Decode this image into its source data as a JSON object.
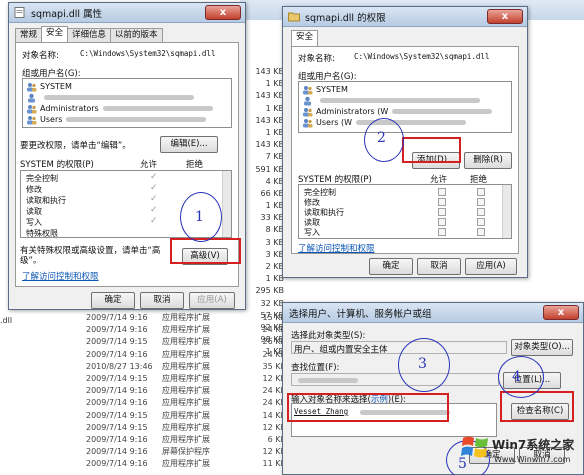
{
  "explorer": {
    "sizes": [
      "143 KB",
      "1 KB",
      "143 KB",
      "1 KB",
      "143 KB",
      "1 KB",
      "143 KB",
      "7 KB",
      "591 KB",
      "4 KB",
      "66 KB",
      "1 KB",
      "33 KB",
      "8 KB",
      "3 KB",
      "3 KB",
      "2 KB",
      "1 KB",
      "295 KB",
      "32 KB",
      "57 KB",
      "92 KB",
      "98 KB",
      "1 KB"
    ],
    "rows": [
      {
        "date": "2009/7/14 9:16",
        "type": "应用程序扩展",
        "size": "15 KB"
      },
      {
        "date": "2009/7/14 9:16",
        "type": "应用程序扩展",
        "size": "24 KB"
      },
      {
        "date": "2009/7/14 9:15",
        "type": "应用程序扩展",
        "size": "26 KB"
      },
      {
        "date": "2009/7/14 9:16",
        "type": "应用程序扩展",
        "size": "24 KB"
      },
      {
        "date": "2010/8/27 13:46",
        "type": "应用程序扩展",
        "size": "35 KB"
      },
      {
        "date": "2009/7/14 9:15",
        "type": "应用程序扩展",
        "size": "12 KB"
      },
      {
        "date": "2009/7/14 9:16",
        "type": "应用程序扩展",
        "size": "24 KB"
      },
      {
        "date": "2009/7/14 9:16",
        "type": "应用程序扩展",
        "size": "24 KB"
      },
      {
        "date": "2009/7/14 9:15",
        "type": "应用程序扩展",
        "size": "14 KB"
      },
      {
        "date": "2009/7/14 9:15",
        "type": "应用程序扩展",
        "size": "12 KB"
      },
      {
        "date": "2009/7/14 9:16",
        "type": "应用程序扩展",
        "size": "6 KB"
      },
      {
        "date": "2009/7/14 9:16",
        "type": "屏幕保护程序",
        "size": "12 KB"
      },
      {
        "date": "2009/7/14 9:16",
        "type": "应用程序扩展",
        "size": "11 KB"
      }
    ],
    "left_fragment": ".dll"
  },
  "props": {
    "title": "sqmapi.dll 属性",
    "tabs": [
      "常规",
      "安全",
      "详细信息",
      "以前的版本"
    ],
    "object_label": "对象名称:",
    "object_value": "C:\\Windows\\System32\\sqmapi.dll",
    "group_label": "组或用户名(G):",
    "users": [
      "SYSTEM",
      "",
      "Administrators",
      "Users"
    ],
    "change_hint": "要更改权限，请单击“编辑”。",
    "edit_button": "编辑(E)...",
    "perm_header": "SYSTEM 的权限(P)",
    "allow_header": "允许",
    "deny_header": "拒绝",
    "perms": [
      "完全控制",
      "修改",
      "读取和执行",
      "读取",
      "写入",
      "特殊权限"
    ],
    "adv_hint": "有关特殊权限或高级设置，请单击“高级”。",
    "advanced_button": "高级(V)",
    "learn_link": "了解访问控制和权限",
    "ok": "确定",
    "cancel": "取消",
    "apply": "应用(A)",
    "close": "x"
  },
  "perms_dialog": {
    "title": "sqmapi.dll 的权限",
    "tab": "安全",
    "object_label": "对象名称:",
    "object_value": "C:\\Windows\\System32\\sqmapi.dll",
    "group_label": "组或用户名(G):",
    "users": [
      "SYSTEM",
      "",
      "Administrators (W",
      "Users (W"
    ],
    "add_button": "添加(D)...",
    "remove_button": "删除(R)",
    "perm_header": "SYSTEM 的权限(P)",
    "allow_header": "允许",
    "deny_header": "拒绝",
    "perms": [
      "完全控制",
      "修改",
      "读取和执行",
      "读取",
      "写入"
    ],
    "learn_link": "了解访问控制和权限",
    "ok": "确定",
    "cancel": "取消",
    "apply": "应用(A)",
    "close": "x"
  },
  "select_dialog": {
    "title": "选择用户、计算机、服务帐户或组",
    "type_label": "选择此对象类型(S):",
    "type_value": "用户、组或内置安全主体",
    "type_button": "对象类型(O)...",
    "loc_label": "查找位置(F):",
    "loc_button": "位置(L)...",
    "names_label_prefix": "输入对象名称来选择(",
    "names_label_link": "示例",
    "names_label_suffix": ")(E):",
    "names_value": "Vesset Zhang",
    "check_button": "检查名称(C)",
    "ok": "确定",
    "cancel": "取消",
    "close": "x"
  },
  "annotations": [
    "1",
    "2",
    "3",
    "4",
    "5"
  ],
  "watermark": {
    "brand": "Win7系统之家",
    "url": "Www.Winwin7.com"
  },
  "colors": {
    "highlight": "#d42020",
    "annotation": "#2a35b8",
    "link": "#0a55b3"
  }
}
